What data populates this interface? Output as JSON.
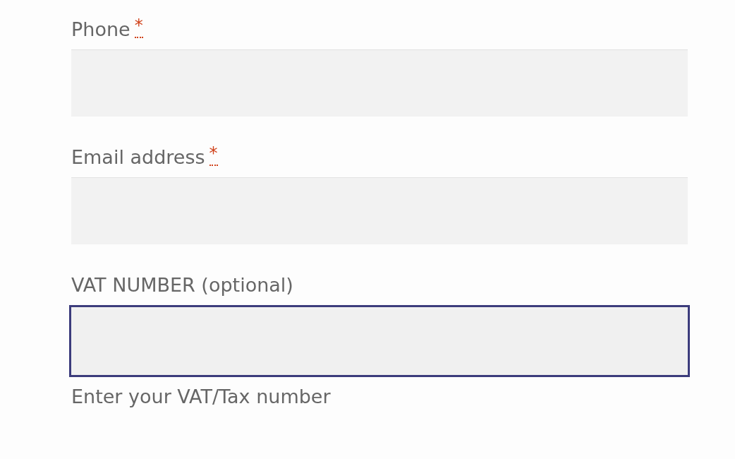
{
  "fields": [
    {
      "label": "Phone",
      "required_mark": "*",
      "focused": false
    },
    {
      "label": "Email address",
      "required_mark": "*",
      "focused": false
    },
    {
      "label": "VAT NUMBER (optional)",
      "focused": true,
      "description": "Enter your VAT/Tax number"
    }
  ]
}
